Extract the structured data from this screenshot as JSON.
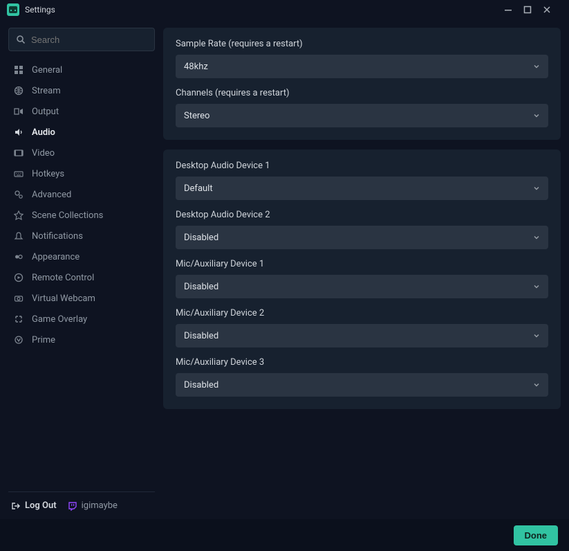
{
  "window": {
    "title": "Settings"
  },
  "search": {
    "placeholder": "Search"
  },
  "sidebar": {
    "items": [
      {
        "label": "General"
      },
      {
        "label": "Stream"
      },
      {
        "label": "Output"
      },
      {
        "label": "Audio"
      },
      {
        "label": "Video"
      },
      {
        "label": "Hotkeys"
      },
      {
        "label": "Advanced"
      },
      {
        "label": "Scene Collections"
      },
      {
        "label": "Notifications"
      },
      {
        "label": "Appearance"
      },
      {
        "label": "Remote Control"
      },
      {
        "label": "Virtual Webcam"
      },
      {
        "label": "Game Overlay"
      },
      {
        "label": "Prime"
      }
    ],
    "logout": "Log Out",
    "username": "igimaybe"
  },
  "audio": {
    "group1": [
      {
        "label": "Sample Rate (requires a restart)",
        "value": "48khz"
      },
      {
        "label": "Channels (requires a restart)",
        "value": "Stereo"
      }
    ],
    "group2": [
      {
        "label": "Desktop Audio Device 1",
        "value": "Default"
      },
      {
        "label": "Desktop Audio Device 2",
        "value": "Disabled"
      },
      {
        "label": "Mic/Auxiliary Device 1",
        "value": "Disabled"
      },
      {
        "label": "Mic/Auxiliary Device 2",
        "value": "Disabled"
      },
      {
        "label": "Mic/Auxiliary Device 3",
        "value": "Disabled"
      }
    ]
  },
  "footer": {
    "done": "Done"
  }
}
